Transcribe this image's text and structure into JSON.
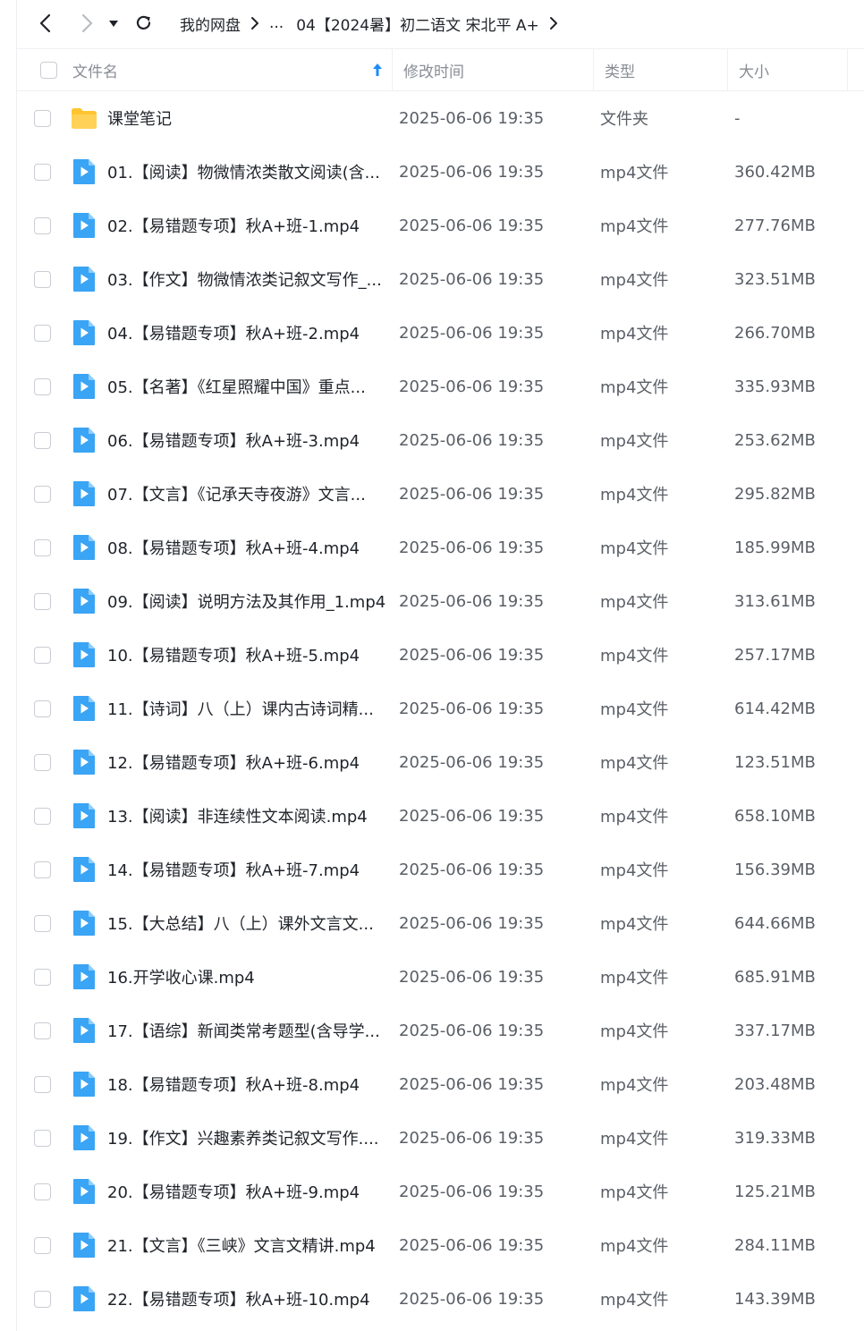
{
  "toolbar": {
    "breadcrumb": [
      "我的网盘",
      "...",
      "04【2024暑】初二语文 宋北平 A+"
    ]
  },
  "header": {
    "name": "文件名",
    "time": "修改时间",
    "type": "类型",
    "size": "大小"
  },
  "files": [
    {
      "name": "课堂笔记",
      "time": "2025-06-06 19:35",
      "type": "文件夹",
      "size": "-",
      "icon": "folder-icon"
    },
    {
      "name": "01.【阅读】物微情浓类散文阅读(含...",
      "time": "2025-06-06 19:35",
      "type": "mp4文件",
      "size": "360.42MB",
      "icon": "video-icon"
    },
    {
      "name": "02.【易错题专项】秋A+班-1.mp4",
      "time": "2025-06-06 19:35",
      "type": "mp4文件",
      "size": "277.76MB",
      "icon": "video-icon"
    },
    {
      "name": "03.【作文】物微情浓类记叙文写作_...",
      "time": "2025-06-06 19:35",
      "type": "mp4文件",
      "size": "323.51MB",
      "icon": "video-icon"
    },
    {
      "name": "04.【易错题专项】秋A+班-2.mp4",
      "time": "2025-06-06 19:35",
      "type": "mp4文件",
      "size": "266.70MB",
      "icon": "video-icon"
    },
    {
      "name": "05.【名著】《红星照耀中国》重点...",
      "time": "2025-06-06 19:35",
      "type": "mp4文件",
      "size": "335.93MB",
      "icon": "video-icon"
    },
    {
      "name": "06.【易错题专项】秋A+班-3.mp4",
      "time": "2025-06-06 19:35",
      "type": "mp4文件",
      "size": "253.62MB",
      "icon": "video-icon"
    },
    {
      "name": "07.【文言】《记承天寺夜游》文言...",
      "time": "2025-06-06 19:35",
      "type": "mp4文件",
      "size": "295.82MB",
      "icon": "video-icon"
    },
    {
      "name": "08.【易错题专项】秋A+班-4.mp4",
      "time": "2025-06-06 19:35",
      "type": "mp4文件",
      "size": "185.99MB",
      "icon": "video-icon"
    },
    {
      "name": "09.【阅读】说明方法及其作用_1.mp4",
      "time": "2025-06-06 19:35",
      "type": "mp4文件",
      "size": "313.61MB",
      "icon": "video-icon"
    },
    {
      "name": "10.【易错题专项】秋A+班-5.mp4",
      "time": "2025-06-06 19:35",
      "type": "mp4文件",
      "size": "257.17MB",
      "icon": "video-icon"
    },
    {
      "name": "11.【诗词】八（上）课内古诗词精...",
      "time": "2025-06-06 19:35",
      "type": "mp4文件",
      "size": "614.42MB",
      "icon": "video-icon"
    },
    {
      "name": "12.【易错题专项】秋A+班-6.mp4",
      "time": "2025-06-06 19:35",
      "type": "mp4文件",
      "size": "123.51MB",
      "icon": "video-icon"
    },
    {
      "name": "13.【阅读】非连续性文本阅读.mp4",
      "time": "2025-06-06 19:35",
      "type": "mp4文件",
      "size": "658.10MB",
      "icon": "video-icon"
    },
    {
      "name": "14.【易错题专项】秋A+班-7.mp4",
      "time": "2025-06-06 19:35",
      "type": "mp4文件",
      "size": "156.39MB",
      "icon": "video-icon"
    },
    {
      "name": "15.【大总结】八（上）课外文言文...",
      "time": "2025-06-06 19:35",
      "type": "mp4文件",
      "size": "644.66MB",
      "icon": "video-icon"
    },
    {
      "name": "16.开学收心课.mp4",
      "time": "2025-06-06 19:35",
      "type": "mp4文件",
      "size": "685.91MB",
      "icon": "video-icon"
    },
    {
      "name": "17.【语综】新闻类常考题型(含导学...",
      "time": "2025-06-06 19:35",
      "type": "mp4文件",
      "size": "337.17MB",
      "icon": "video-icon"
    },
    {
      "name": "18.【易错题专项】秋A+班-8.mp4",
      "time": "2025-06-06 19:35",
      "type": "mp4文件",
      "size": "203.48MB",
      "icon": "video-icon"
    },
    {
      "name": "19.【作文】兴趣素养类记叙文写作....",
      "time": "2025-06-06 19:35",
      "type": "mp4文件",
      "size": "319.33MB",
      "icon": "video-icon"
    },
    {
      "name": "20.【易错题专项】秋A+班-9.mp4",
      "time": "2025-06-06 19:35",
      "type": "mp4文件",
      "size": "125.21MB",
      "icon": "video-icon"
    },
    {
      "name": "21.【文言】《三峡》文言文精讲.mp4",
      "time": "2025-06-06 19:35",
      "type": "mp4文件",
      "size": "284.11MB",
      "icon": "video-icon"
    },
    {
      "name": "22.【易错题专项】秋A+班-10.mp4",
      "time": "2025-06-06 19:35",
      "type": "mp4文件",
      "size": "143.39MB",
      "icon": "video-icon"
    }
  ],
  "colors": {
    "accent": "#1a8cff",
    "video_icon": "#3aa4f5",
    "folder": "#ffc531"
  }
}
